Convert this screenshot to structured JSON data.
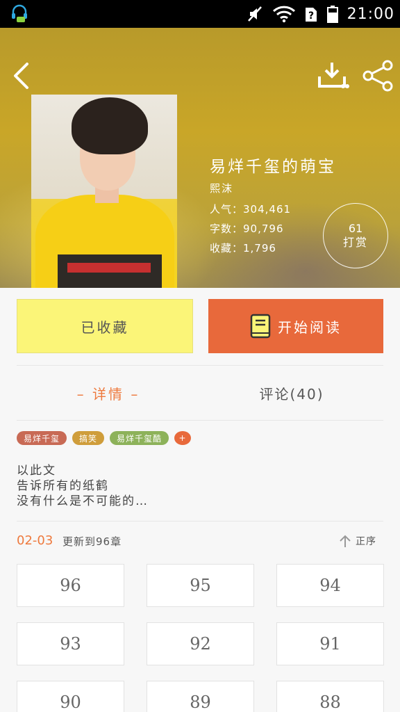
{
  "status_bar": {
    "time": "21:00",
    "icons": [
      "headset-chat-icon",
      "mute-icon",
      "wifi-icon",
      "sim-unknown-icon",
      "battery-icon"
    ]
  },
  "header": {
    "back_icon": "chevron-left-icon",
    "download_icon": "download-icon",
    "share_icon": "share-icon"
  },
  "book": {
    "title": "易烊千玺的萌宝",
    "author": "熙沫",
    "popularity": "人气：304,461",
    "word_count": "字数：90,796",
    "favorites": "收藏：1,796",
    "tips": {
      "count": "61",
      "label": "打赏"
    }
  },
  "actions": {
    "collected_label": "已收藏",
    "read_label": "开始阅读"
  },
  "tabs": {
    "detail": "– 详情 –",
    "comments": "评论(40)"
  },
  "tags": [
    {
      "label": "易烊千玺",
      "color": "#c86a55"
    },
    {
      "label": "搞笑",
      "color": "#cf9d3b"
    },
    {
      "label": "易烊千玺酷",
      "color": "#8db25a"
    },
    {
      "label": "+",
      "color": "#e8693b"
    }
  ],
  "description": [
    "以此文",
    "告诉所有的纸鹤",
    "没有什么是不可能的…"
  ],
  "update": {
    "date": "02-03",
    "text": "更新到96章",
    "sort_label": "正序"
  },
  "chapters": [
    "96",
    "95",
    "94",
    "93",
    "92",
    "91",
    "90",
    "89",
    "88"
  ],
  "colors": {
    "accent": "#ee7a3e",
    "read_button": "#e8693b",
    "collect_button": "#fbf578"
  }
}
